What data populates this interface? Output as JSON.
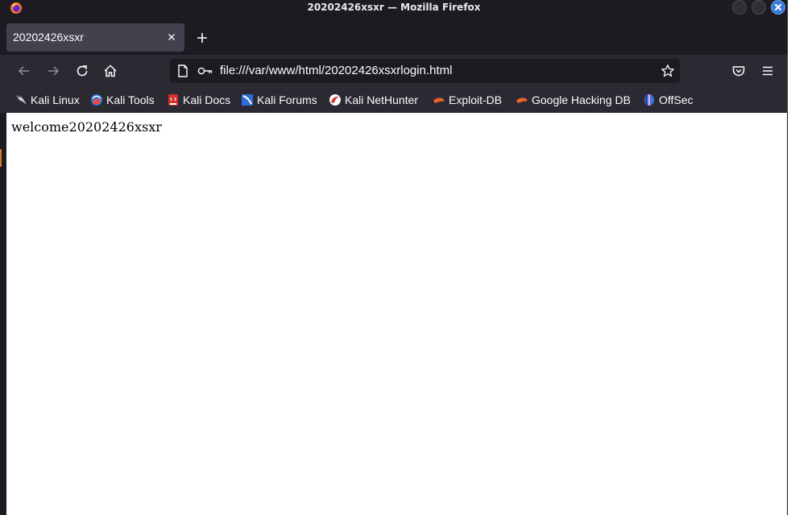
{
  "window": {
    "title": "20202426xsxr — Mozilla Firefox"
  },
  "tabs": [
    {
      "label": "20202426xsxr",
      "active": true
    }
  ],
  "navbar": {
    "url": "file:///var/www/html/20202426xsxrlogin.html"
  },
  "bookmarks": [
    {
      "label": "Kali Linux",
      "icon": "kali-dragon-icon"
    },
    {
      "label": "Kali Tools",
      "icon": "kali-tools-icon"
    },
    {
      "label": "Kali Docs",
      "icon": "kali-docs-icon"
    },
    {
      "label": "Kali Forums",
      "icon": "kali-forums-icon"
    },
    {
      "label": "Kali NetHunter",
      "icon": "kali-nethunter-icon"
    },
    {
      "label": "Exploit-DB",
      "icon": "exploit-db-icon"
    },
    {
      "label": "Google Hacking DB",
      "icon": "ghdb-icon"
    },
    {
      "label": "OffSec",
      "icon": "offsec-icon"
    }
  ],
  "page": {
    "text": "welcome20202426xsxr"
  },
  "colors": {
    "chrome_dark": "#1c1b22",
    "toolbar": "#2b2a33",
    "tab_active": "#42414d",
    "close_button": "#3a79d8"
  }
}
